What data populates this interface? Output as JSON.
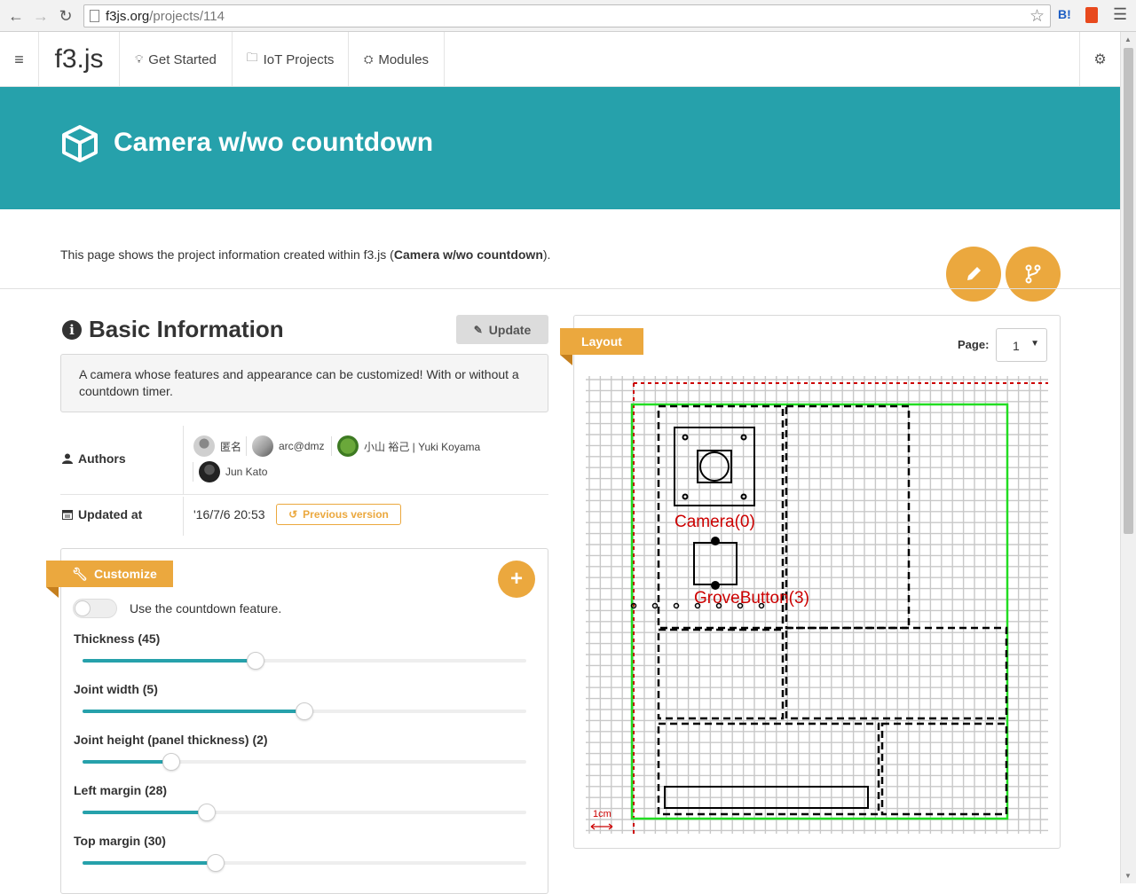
{
  "browser": {
    "url_host": "f3js.org",
    "url_path": "/projects/114"
  },
  "navbar": {
    "brand": "f3.js",
    "items": [
      {
        "label": "Get Started",
        "icon": "lightbulb-icon"
      },
      {
        "label": "IoT Projects",
        "icon": "folder-open-icon"
      },
      {
        "label": "Modules",
        "icon": "cubes-icon"
      }
    ]
  },
  "banner": {
    "title": "Camera w/wo countdown"
  },
  "intro": {
    "prefix": "This page shows the project information created within f3.js (",
    "project_name": "Camera w/wo countdown",
    "suffix": ")."
  },
  "basic_info": {
    "title": "Basic Information",
    "update_label": "Update",
    "description": "A camera whose features and appearance can be customized! With or without a countdown timer.",
    "authors_label": "Authors",
    "authors": [
      "匿名",
      "arc@dmz",
      "小山 裕己 | Yuki Koyama",
      "Jun Kato"
    ],
    "updated_label": "Updated at",
    "updated_value": "'16/7/6 20:53",
    "previous_version_label": "Previous version"
  },
  "customize": {
    "ribbon_label": "Customize",
    "toggle_label": "Use the countdown feature.",
    "toggle_on": false,
    "sliders": [
      {
        "label": "Thickness (45)",
        "fraction": 0.39
      },
      {
        "label": "Joint width (5)",
        "fraction": 0.5
      },
      {
        "label": "Joint height (panel thickness) (2)",
        "fraction": 0.2
      },
      {
        "label": "Left margin (28)",
        "fraction": 0.28
      },
      {
        "label": "Top margin (30)",
        "fraction": 0.3
      }
    ]
  },
  "layout": {
    "ribbon_label": "Layout",
    "page_label": "Page:",
    "page_value": "1",
    "labels": [
      "Camera(0)",
      "GroveButton(3)"
    ],
    "scale_label": "1cm"
  },
  "colors": {
    "teal": "#26a1ab",
    "orange": "#eba83e",
    "green_outline": "#22dd22",
    "red_guide": "#cc0000"
  }
}
